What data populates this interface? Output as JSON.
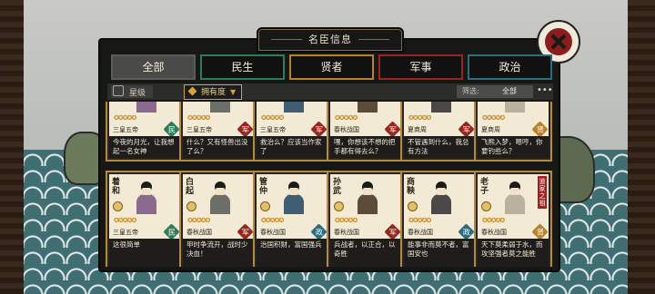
{
  "panel": {
    "title": "名臣信息",
    "tabs": [
      {
        "label": "全部",
        "color": "#4a4a48",
        "active": true
      },
      {
        "label": "民生",
        "color": "#2f7c5b",
        "active": false
      },
      {
        "label": "贤者",
        "color": "#b8822a",
        "active": false
      },
      {
        "label": "军事",
        "color": "#9a2420",
        "active": false
      },
      {
        "label": "政治",
        "color": "#2c6c80",
        "active": false
      }
    ],
    "filter": {
      "stars_label": "星级",
      "sort_label": "拥有度",
      "filter_label": "筛选:",
      "filter_value": "全部",
      "more": "•••"
    }
  },
  "top_row": [
    {
      "name": "",
      "dynasty": "三皇五帝",
      "badge": "民",
      "badge_color": "#2f7c5b",
      "desc": "今夜的月光，让我想起一名女神",
      "stars": 5
    },
    {
      "name": "",
      "dynasty": "三皇五帝",
      "badge": "军",
      "badge_color": "#9a2420",
      "desc": "什么？又有怪兽出没了么？",
      "stars": 5
    },
    {
      "name": "",
      "dynasty": "三皇五帝",
      "badge": "军",
      "badge_color": "#9a2420",
      "desc": "救治么？应该当作家了",
      "stars": 5
    },
    {
      "name": "",
      "dynasty": "春秋战国",
      "badge": "军",
      "badge_color": "#9a2420",
      "desc": "嘿，你想该不想的把手都有得去么？",
      "stars": 5
    },
    {
      "name": "",
      "dynasty": "夏商周",
      "badge": "军",
      "badge_color": "#9a2420",
      "desc": "不管遇到什么，我总有方法",
      "stars": 5
    },
    {
      "name": "",
      "dynasty": "夏商周",
      "badge": "贤",
      "badge_color": "#b8822a",
      "desc": "飞熊入梦，嗯哼，你要钓些么？",
      "stars": 5
    }
  ],
  "bottom_row": [
    {
      "name": "着和",
      "dynasty": "三皇五帝",
      "badge": "民",
      "badge_color": "#2f7c5b",
      "desc": "这很简单",
      "stars": 5,
      "tag": ""
    },
    {
      "name": "白起",
      "dynasty": "春秋战国",
      "badge": "军",
      "badge_color": "#9a2420",
      "desc": "甲时争流开，战时少决血！",
      "stars": 5,
      "tag": ""
    },
    {
      "name": "管仲",
      "dynasty": "春秋战国",
      "badge": "政",
      "badge_color": "#2c6c80",
      "desc": "治国积财，富国强兵",
      "stars": 5,
      "tag": ""
    },
    {
      "name": "孙武",
      "dynasty": "春秋战国",
      "badge": "军",
      "badge_color": "#9a2420",
      "desc": "兵战者，以正合，以奇胜",
      "stars": 5,
      "tag": ""
    },
    {
      "name": "商鞅",
      "dynasty": "春秋战国",
      "badge": "政",
      "badge_color": "#2c6c80",
      "desc": "能事非而莫不者，富国安也",
      "stars": 5,
      "tag": ""
    },
    {
      "name": "老子",
      "dynasty": "春秋战国",
      "badge": "贤",
      "badge_color": "#b8822a",
      "desc": "天下莫柔弱于水，而攻坚强者莫之能胜",
      "stars": 5,
      "tag": "道家之祖"
    }
  ]
}
